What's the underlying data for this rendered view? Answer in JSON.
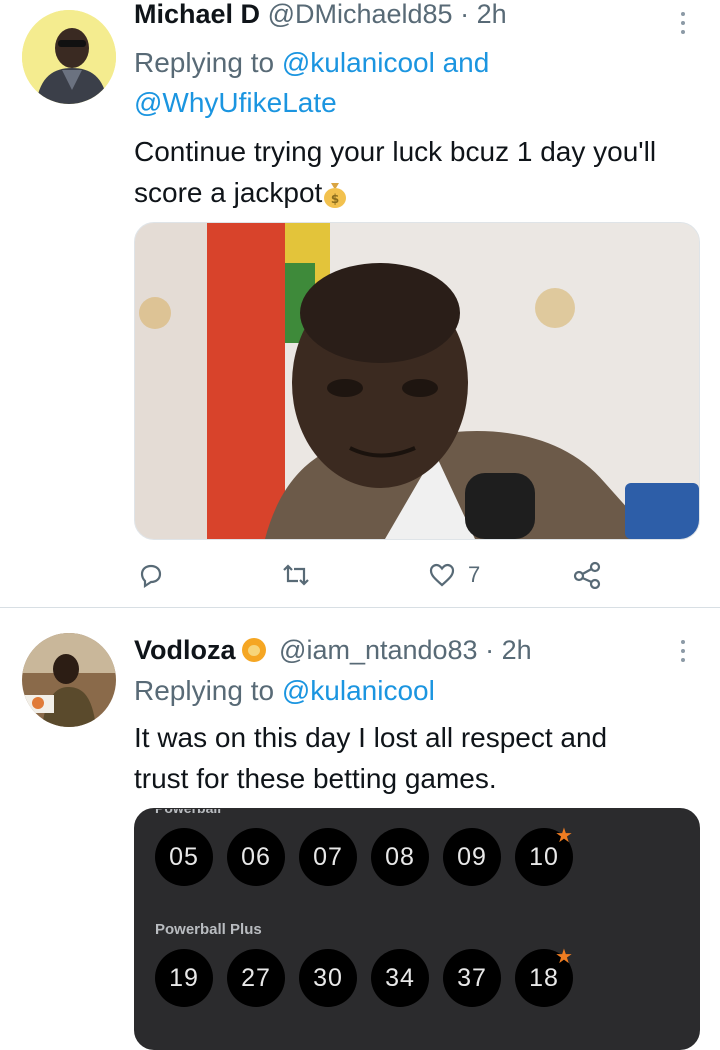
{
  "tweets": [
    {
      "name": "Michael D",
      "handle": "@DMichaeld85",
      "time": "· 2h",
      "replying_prefix": "Replying to ",
      "replying_line1": "@kulanicool and",
      "replying_line2": "@WhyUfikeLate",
      "text_line1": "Continue trying your luck bcuz 1 day you'll",
      "text_line2": "score a jackpot",
      "emoji": "money-bag-icon",
      "like_count": "7",
      "media_description_icon": "photo"
    },
    {
      "name": "Vodloza",
      "name_emoji": "lion-face-icon",
      "handle": "@iam_ntando83",
      "time": "· 2h",
      "replying_prefix": "Replying to ",
      "replying_line1": "@kulanicool",
      "text_line1": "It was on this day I lost all respect and",
      "text_line2": "trust for these betting games.",
      "lottery": {
        "top_label_partial": "Powerball",
        "row1": [
          "05",
          "06",
          "07",
          "08",
          "09",
          "10"
        ],
        "plus_label": "Powerball Plus",
        "row2": [
          "19",
          "27",
          "30",
          "34",
          "37",
          "18"
        ]
      }
    }
  ],
  "colors": {
    "link": "#1b95e0",
    "secondary_text": "#586a76",
    "primary_text": "#0f1419",
    "star": "#ef7d22",
    "lottery_bg": "#2b2b2d"
  }
}
